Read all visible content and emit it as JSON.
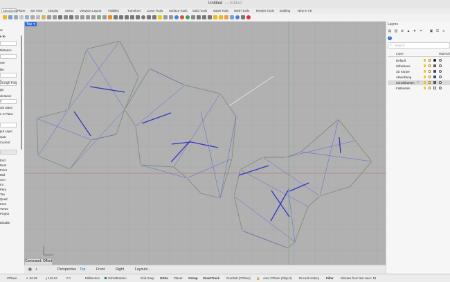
{
  "window": {
    "title": "Untitled",
    "edited": "— Edited"
  },
  "tabs": [
    "Standard",
    "CPlane",
    "Set View",
    "Display",
    "Select",
    "Viewport Layout",
    "Visibility",
    "Transform",
    "Curve Tools",
    "Surface Tools",
    "Solid Tools",
    "SubD Tools",
    "Mesh Tools",
    "Render Tools",
    "Drafting",
    "New in V8"
  ],
  "left_panel": {
    "items": [
      "et",
      "e to",
      "Distance",
      "ose",
      "lter",
      "s",
      "hrough Poin",
      "gin",
      "olerance",
      "t",
      "oth Sides",
      "n C Plane",
      "put Layer",
      "nput",
      "Current",
      "End",
      "Near",
      "Point",
      "Mid",
      "Cen",
      "Int",
      "Perp",
      "Tan",
      "Quad",
      "Knot",
      "Vertex",
      "Project",
      "Disable"
    ]
  },
  "viewport": {
    "name": "Top",
    "dropdown": "▾"
  },
  "command": {
    "text": "Command: Offset"
  },
  "view_tabs": [
    {
      "label": "Perspective",
      "active": false
    },
    {
      "label": "Top",
      "active": true
    },
    {
      "label": "Front",
      "active": false
    },
    {
      "label": "Right",
      "active": false
    },
    {
      "label": "Layouts...",
      "active": false
    }
  ],
  "status": {
    "cplane": "CPlane",
    "x": "x -96.28",
    "y": "y 146.94",
    "z": "z 0",
    "units": "Millimeters",
    "layer": "Schnittkanten",
    "grid_snap": "Grid Snap",
    "ortho": "Ortho",
    "planar": "Planar",
    "osnap": "Osnap",
    "smarttrack": "SmartTrack",
    "gumball": "Gumball (CPlane)",
    "auto_cplane": "Auto CPlane (Object)",
    "record_history": "Record History",
    "filter": "Filter",
    "autosave": "Minutes from last save: 18"
  },
  "layers_panel": {
    "title": "Layers",
    "search_placeholder": "Search",
    "col_layer": "Layer",
    "col_material": "Material",
    "rows": [
      {
        "name": "Default",
        "color": "#000000",
        "check": "",
        "selected": false
      },
      {
        "name": "Hilfsebene",
        "color": "#c0392b",
        "check": "",
        "selected": false
      },
      {
        "name": "3D Körper",
        "color": "#2b2b8c",
        "check": "",
        "selected": false
      },
      {
        "name": "Abwicklung",
        "color": "#1e2ad6",
        "check": "",
        "selected": false
      },
      {
        "name": "Schnittkanten",
        "color": "#1f8a2f",
        "check": "✓",
        "selected": true
      },
      {
        "name": "Faltkanten",
        "color": "#ffffff",
        "check": "",
        "selected": false
      }
    ]
  },
  "colors": {
    "accent": "#2f6bd6",
    "viewport_bg": "#b1b1b1",
    "outline": "#7a8e7c",
    "fold_line": "#3b45c9"
  }
}
